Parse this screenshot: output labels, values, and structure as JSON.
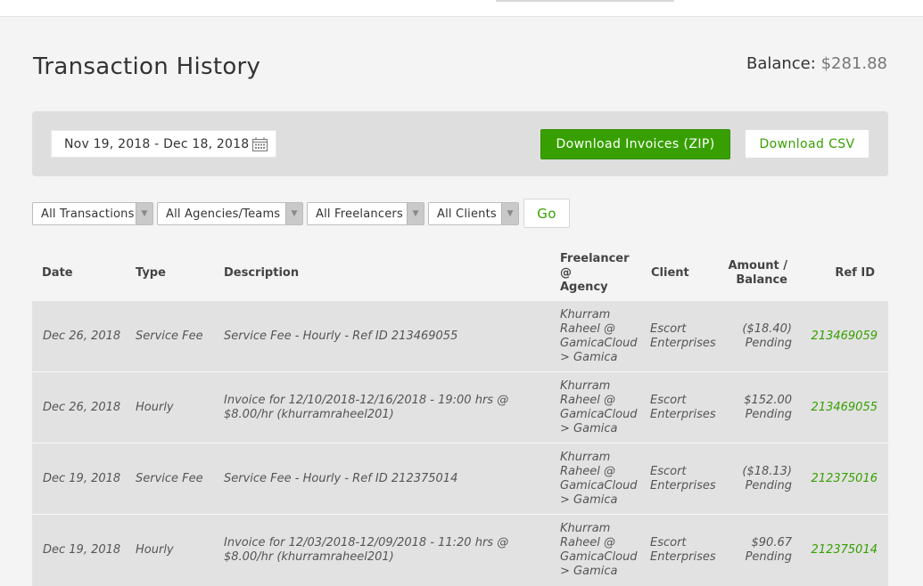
{
  "header": {
    "title": "Transaction History",
    "balance_label": "Balance:",
    "balance_value": "$281.88"
  },
  "filters": {
    "date_range": "Nov 19, 2018 - Dec 18, 2018",
    "download_zip_label": "Download Invoices (ZIP)",
    "download_csv_label": "Download CSV",
    "selects": [
      {
        "selected": "All Transactions"
      },
      {
        "selected": "All Agencies/Teams"
      },
      {
        "selected": "All Freelancers"
      },
      {
        "selected": "All Clients"
      }
    ],
    "go_label": "Go"
  },
  "table": {
    "columns": {
      "date": "Date",
      "type": "Type",
      "description": "Description",
      "freelancer_line1": "Freelancer",
      "freelancer_line2": "@",
      "freelancer_line3": "Agency",
      "client": "Client",
      "amount_line1": "Amount /",
      "amount_line2": "Balance",
      "ref": "Ref ID"
    },
    "rows": [
      {
        "date": "Dec 26, 2018",
        "type": "Service Fee",
        "desc1": "Service Fee - Hourly - Ref ID 213469055",
        "desc2": "",
        "fl1": "Khurram",
        "fl2": "Raheel @",
        "fl3": "GamicaCloud",
        "fl4": "> Gamica",
        "client1": "Escort",
        "client2": "Enterprises",
        "amount": "($18.40)",
        "status": "Pending",
        "ref": "213469059"
      },
      {
        "date": "Dec 26, 2018",
        "type": "Hourly",
        "desc1": "Invoice for 12/10/2018-12/16/2018 - 19:00 hrs @",
        "desc2": "$8.00/hr (khurramraheel201)",
        "fl1": "Khurram",
        "fl2": "Raheel @",
        "fl3": "GamicaCloud",
        "fl4": "> Gamica",
        "client1": "Escort",
        "client2": "Enterprises",
        "amount": "$152.00",
        "status": "Pending",
        "ref": "213469055"
      },
      {
        "date": "Dec 19, 2018",
        "type": "Service Fee",
        "desc1": "Service Fee - Hourly - Ref ID 212375014",
        "desc2": "",
        "fl1": "Khurram",
        "fl2": "Raheel @",
        "fl3": "GamicaCloud",
        "fl4": "> Gamica",
        "client1": "Escort",
        "client2": "Enterprises",
        "amount": "($18.13)",
        "status": "Pending",
        "ref": "212375016"
      },
      {
        "date": "Dec 19, 2018",
        "type": "Hourly",
        "desc1": "Invoice for 12/03/2018-12/09/2018 - 11:20 hrs @",
        "desc2": "$8.00/hr (khurramraheel201)",
        "fl1": "Khurram",
        "fl2": "Raheel @",
        "fl3": "GamicaCloud",
        "fl4": "> Gamica",
        "client1": "Escort",
        "client2": "Enterprises",
        "amount": "$90.67",
        "status": "Pending",
        "ref": "212375014"
      }
    ]
  },
  "colors": {
    "accent": "#37a000",
    "row_bg": "#e2e2e2",
    "panel_bg": "#dedede"
  }
}
